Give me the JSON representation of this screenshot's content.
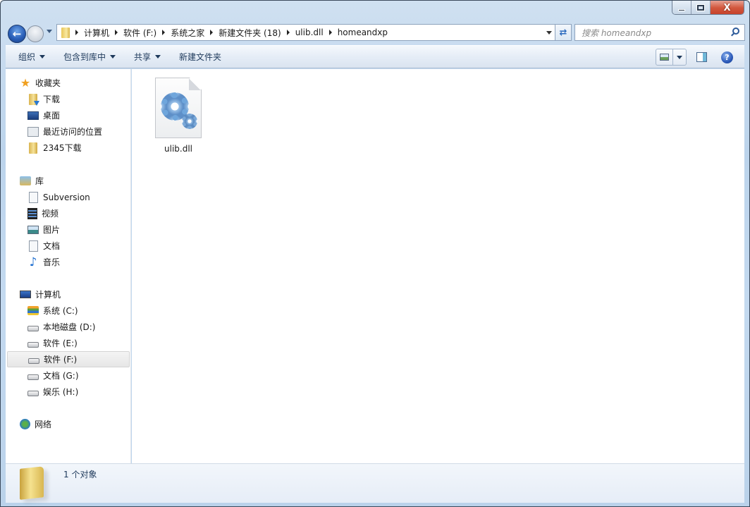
{
  "window": {
    "caption_buttons": {
      "minimize_icon": "minimize-icon",
      "maximize_icon": "maximize-icon",
      "close_icon": "close-icon",
      "close_glyph": "X"
    }
  },
  "navigation": {
    "back_glyph": "←",
    "breadcrumb": [
      "计算机",
      "软件 (F:)",
      "系统之家",
      "新建文件夹 (18)",
      "ulib.dll",
      "homeandxp"
    ],
    "refresh_glyph": "⇄",
    "search": {
      "placeholder": "搜索 homeandxp"
    }
  },
  "toolbar": {
    "commands": [
      {
        "label": "组织",
        "has_dropdown": true
      },
      {
        "label": "包含到库中",
        "has_dropdown": true
      },
      {
        "label": "共享",
        "has_dropdown": true
      },
      {
        "label": "新建文件夹",
        "has_dropdown": false
      }
    ],
    "help_glyph": "?"
  },
  "sidebar": {
    "favorites": {
      "label": "收藏夹",
      "items": [
        {
          "label": "下载",
          "icon": "download-folder-icon"
        },
        {
          "label": "桌面",
          "icon": "desktop-icon"
        },
        {
          "label": "最近访问的位置",
          "icon": "recent-places-icon"
        },
        {
          "label": "2345下载",
          "icon": "folder-icon"
        }
      ]
    },
    "libraries": {
      "label": "库",
      "items": [
        {
          "label": "Subversion",
          "icon": "document-library-icon"
        },
        {
          "label": "视频",
          "icon": "video-icon"
        },
        {
          "label": "图片",
          "icon": "pictures-icon"
        },
        {
          "label": "文档",
          "icon": "documents-icon"
        },
        {
          "label": "音乐",
          "icon": "music-icon"
        }
      ]
    },
    "computer": {
      "label": "计算机",
      "items": [
        {
          "label": "系统 (C:)",
          "icon": "system-drive-icon",
          "selected": false
        },
        {
          "label": "本地磁盘 (D:)",
          "icon": "drive-icon",
          "selected": false
        },
        {
          "label": "软件 (E:)",
          "icon": "drive-icon",
          "selected": false
        },
        {
          "label": "软件 (F:)",
          "icon": "drive-icon",
          "selected": true
        },
        {
          "label": "文档 (G:)",
          "icon": "drive-icon",
          "selected": false
        },
        {
          "label": "娱乐 (H:)",
          "icon": "drive-icon",
          "selected": false
        }
      ]
    },
    "network": {
      "label": "网络"
    },
    "star_glyph": "★",
    "note_glyph": "♪"
  },
  "content": {
    "files": [
      {
        "name": "ulib.dll",
        "icon": "dll-gear-file-icon"
      }
    ]
  },
  "details": {
    "count_text": "1 个对象"
  }
}
